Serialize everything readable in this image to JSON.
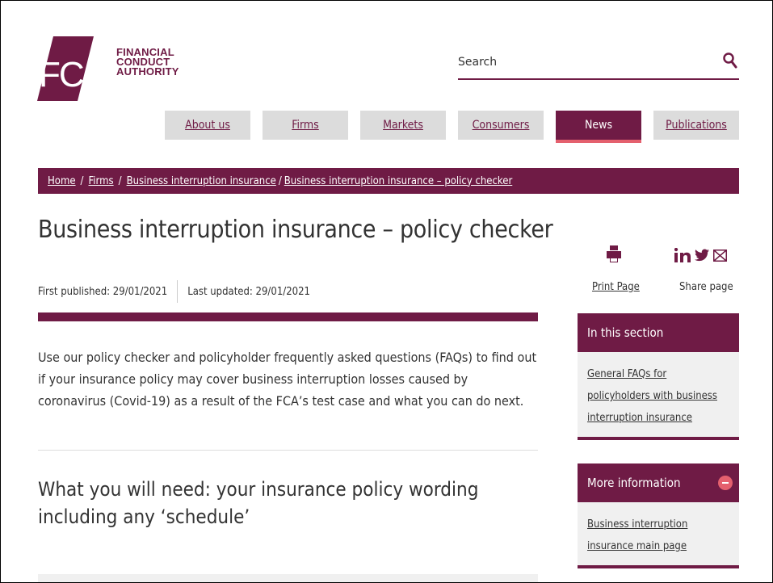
{
  "header": {
    "logo_letters": "FCA",
    "logo_line1": "FINANCIAL",
    "logo_line2": "CONDUCT",
    "logo_line3": "AUTHORITY",
    "search_placeholder": "Search"
  },
  "nav": {
    "items": [
      {
        "label": "About us"
      },
      {
        "label": "Firms"
      },
      {
        "label": "Markets"
      },
      {
        "label": "Consumers"
      },
      {
        "label": "News"
      },
      {
        "label": "Publications"
      }
    ],
    "active": "News"
  },
  "breadcrumb": {
    "home": "Home",
    "sep": "/",
    "firms": "Firms",
    "bii": "Business interruption insurance",
    "current": "Business interruption insurance – policy checker"
  },
  "page": {
    "title": "Business interruption insurance – policy checker",
    "first_published": "First published: 29/01/2021",
    "last_updated": "Last updated: 29/01/2021",
    "intro": "Use our policy checker and policyholder frequently asked questions (FAQs) to find out if your insurance policy may cover business interruption losses caused by coronavirus (Covid-19) as a result of the FCA’s test case and what you can do next.",
    "subhead": "What you will need: your insurance policy wording including any ‘schedule’"
  },
  "sidebar": {
    "print_label": "Print Page",
    "share_label": "Share page",
    "in_this_section": {
      "heading": "In this section",
      "link": "General FAQs for policyholders with business interruption insurance"
    },
    "more_information": {
      "heading": "More information",
      "link": "Business interruption insurance main page"
    }
  },
  "colors": {
    "brand": "#6f1b45",
    "accent": "#e4606e",
    "nav_bg": "#dcdcdc",
    "side_bg": "#f0f0f0"
  }
}
